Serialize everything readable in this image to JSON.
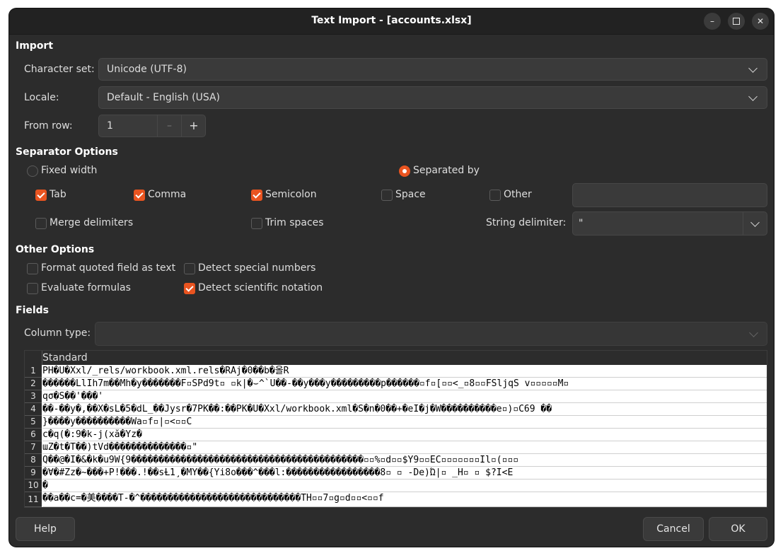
{
  "window": {
    "title": "Text Import - [accounts.xlsx]"
  },
  "import": {
    "heading": "Import",
    "charset_label": "Character set:",
    "charset_value": "Unicode (UTF-8)",
    "locale_label": "Locale:",
    "locale_value": "Default - English (USA)",
    "from_row_label": "From row:",
    "from_row_value": "1"
  },
  "separator": {
    "heading": "Separator Options",
    "fixed_width": "Fixed width",
    "separated_by": "Separated by",
    "tab": "Tab",
    "comma": "Comma",
    "semicolon": "Semicolon",
    "space": "Space",
    "other": "Other",
    "merge": "Merge delimiters",
    "trim": "Trim spaces",
    "string_delim_label": "String delimiter:",
    "string_delim_value": "\""
  },
  "other": {
    "heading": "Other Options",
    "format_quoted": "Format quoted field as text",
    "detect_special": "Detect special numbers",
    "evaluate": "Evaluate formulas",
    "detect_sci": "Detect scientific notation"
  },
  "fields": {
    "heading": "Fields",
    "column_type_label": "Column type:",
    "column_header": "Standard",
    "row_numbers": [
      "1",
      "2",
      "3",
      "4",
      "5",
      "6",
      "7",
      "8",
      "9",
      "10",
      "11"
    ],
    "rows": [
      "PH�U�Xxl/_rels/workbook.xml.rels�RAj�0��b�올R",
      "������LlIh7m��Mh�y�������F▫SPd9t▫          ▫k|�⌣^`U��-��y���y���������p������▫f▫[▫▫<_▫8▫▫FSljqS v▫▫▫▫▫M▫",
      "qσ�S��'���'",
      "��-��y�,��X�sL�5�dL_��Jysr�7PK��:��PK�U�Xxl/workbook.xml�S�n�0��+�eI�j�W����������e▫)▫C69        ��",
      "}����y����������Wa▫f▫|▫<▫▫C",
      "c�q(�:9�k-j(xă�Yz�",
      "ɯZ�t�T��)tVd��������������▫\"",
      "Q��@�I�&�k�u9W{9������������������������������������������▫▫%▫d▫▫$Y9▫▫EC▫▫▫▫▫▫▫Il▫(▫▫▫",
      "�Ɐ�#Zz�~���+P!���.!��sȽ1¸�MY��{Yi8o���^���l:�����������������8▫ ▫ -De)Ώ|▫ _H▫ ▫ $?I<E",
      "�",
      "��a��c=�美����T-�^�����������������������������TH▫▫7▫g▫d▫▫<▫▫f"
    ]
  },
  "footer": {
    "help": "Help",
    "cancel": "Cancel",
    "ok": "OK"
  }
}
